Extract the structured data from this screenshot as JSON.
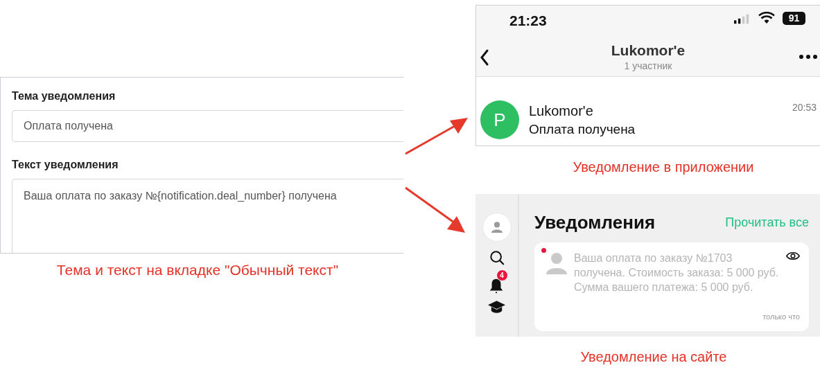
{
  "editor": {
    "fields": [
      {
        "kind": "input",
        "label": "Тема уведомления",
        "value": "Оплата получена"
      },
      {
        "kind": "textarea",
        "label": "Текст уведомления",
        "value": "Ваша оплата по заказу №{notification.deal_number} получена"
      }
    ],
    "caption": "Тема и текст на вкладке \"Обычный текст\""
  },
  "app_notification": {
    "status_bar": {
      "time": "21:23",
      "battery": "91"
    },
    "header": {
      "title": "Lukomor'e",
      "subtitle": "1 участник"
    },
    "chat": {
      "avatar_letter": "P",
      "name": "Lukomor'e",
      "message": "Оплата получена",
      "time": "20:53"
    },
    "caption": "Уведомление в приложении"
  },
  "site_notification": {
    "sidebar": {
      "badge": "4"
    },
    "title": "Уведомления",
    "mark_all_read": "Прочитать все",
    "notifications": [
      {
        "text": "Ваша оплата по заказу №1703 получена. Стоимость заказа: 5 000 руб. Сумма вашего платежа: 5 000 руб.",
        "time": "только что",
        "unread": true
      }
    ],
    "caption": "Уведомление на сайте"
  }
}
